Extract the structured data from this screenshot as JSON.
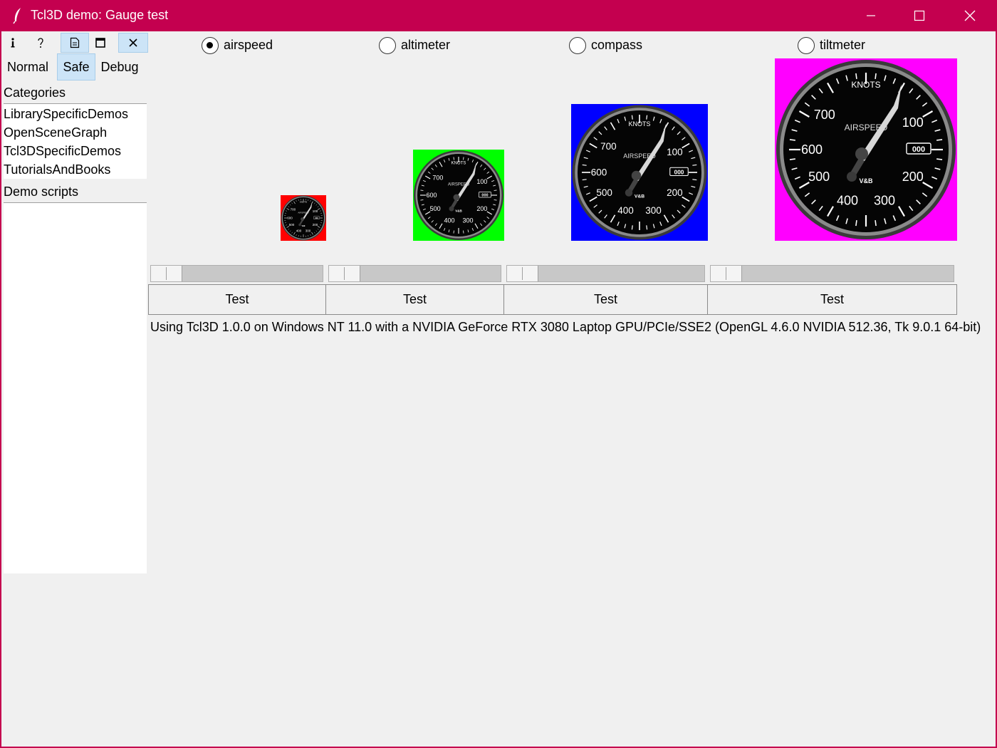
{
  "window": {
    "title": "Tcl3D demo: Gauge test"
  },
  "toolbar": {
    "info_icon": "info-icon",
    "help_icon": "help-icon",
    "source_icon": "document-icon",
    "fullscreen_icon": "window-icon",
    "close_icon": "close-icon"
  },
  "modes": [
    "Normal",
    "Safe",
    "Debug"
  ],
  "selected_mode": "Safe",
  "sidebar": {
    "categories_label": "Categories",
    "categories": [
      "LibrarySpecificDemos",
      "OpenSceneGraph",
      "Tcl3DSpecificDemos",
      "TutorialsAndBooks"
    ],
    "demo_scripts_label": "Demo scripts"
  },
  "gauge_types": [
    {
      "label": "airspeed",
      "selected": true
    },
    {
      "label": "altimeter",
      "selected": false
    },
    {
      "label": "compass",
      "selected": false
    },
    {
      "label": "tiltmeter",
      "selected": false
    }
  ],
  "gauges": {
    "dial_title": "KNOTS",
    "dial_name": "AIRSPEED",
    "dial_brand": "V&B",
    "counter": "000",
    "scale_labels": [
      "100",
      "200",
      "300",
      "400",
      "500",
      "600",
      "700"
    ],
    "backgrounds": [
      "#ff0000",
      "#00ff00",
      "#0000ff",
      "#ff00ff"
    ]
  },
  "tests": [
    "Test",
    "Test",
    "Test",
    "Test"
  ],
  "status": "Using Tcl3D 1.0.0 on Windows NT 11.0 with a NVIDIA GeForce RTX 3080 Laptop GPU/PCIe/SSE2 (OpenGL 4.6.0 NVIDIA 512.36, Tk 9.0.1 64-bit)",
  "colors": {
    "titlebar": "#c4004f",
    "selection": "#cce4f7"
  }
}
